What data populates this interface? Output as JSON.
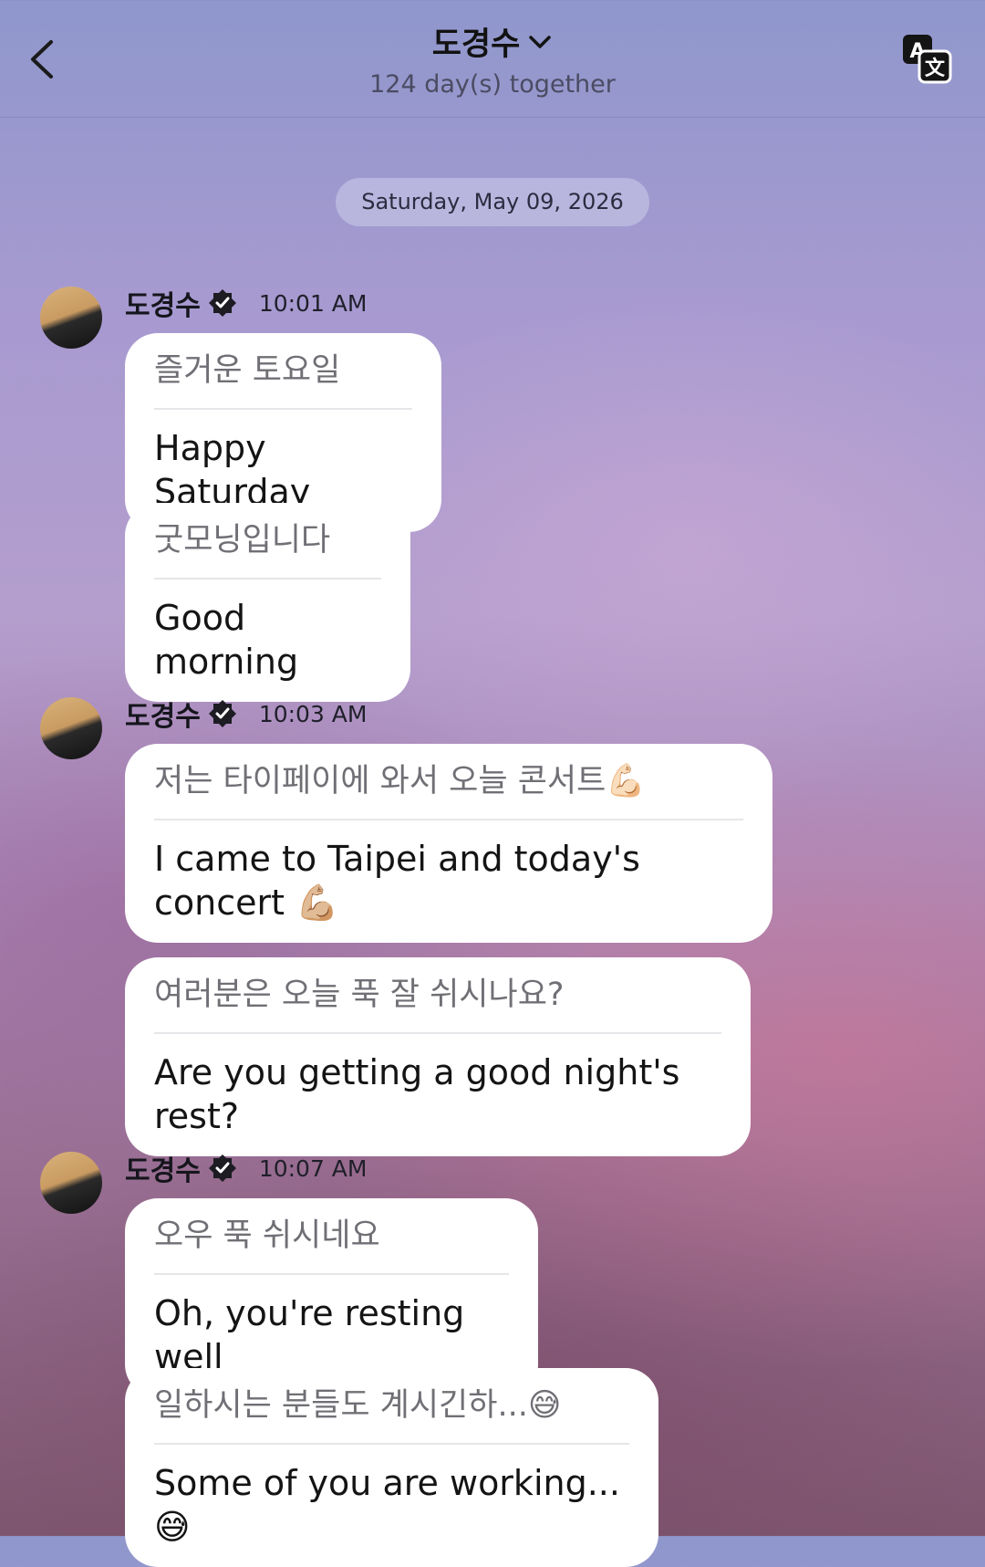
{
  "header": {
    "title": "도경수",
    "subtitle": "124 day(s) together",
    "back_icon": "chevron-left-icon",
    "dropdown_icon": "chevron-down-icon",
    "translate_icon": "translate-icon"
  },
  "date_separator": "Saturday, May 09, 2026",
  "groups": [
    {
      "sender": "도경수",
      "time": "10:01 AM",
      "messages": [
        {
          "ko": "즐거운 토요일",
          "en": "Happy Saturday"
        },
        {
          "ko": "굿모닝입니다",
          "en": "Good morning"
        }
      ]
    },
    {
      "sender": "도경수",
      "time": "10:03 AM",
      "messages": [
        {
          "ko": "저는 타이페이에 와서 오늘 콘서트💪🏻",
          "en": "I came to Taipei and today's concert 💪🏼"
        },
        {
          "ko": "여러분은 오늘 푹 잘 쉬시나요?",
          "en": "Are you getting a good night's rest?"
        }
      ]
    },
    {
      "sender": "도경수",
      "time": "10:07 AM",
      "messages": [
        {
          "ko": "오우 푹 쉬시네요",
          "en": "Oh, you're resting well"
        },
        {
          "ko": "일하시는 분들도 계시긴하...😅",
          "en": "Some of you are working... 😅"
        }
      ]
    }
  ]
}
